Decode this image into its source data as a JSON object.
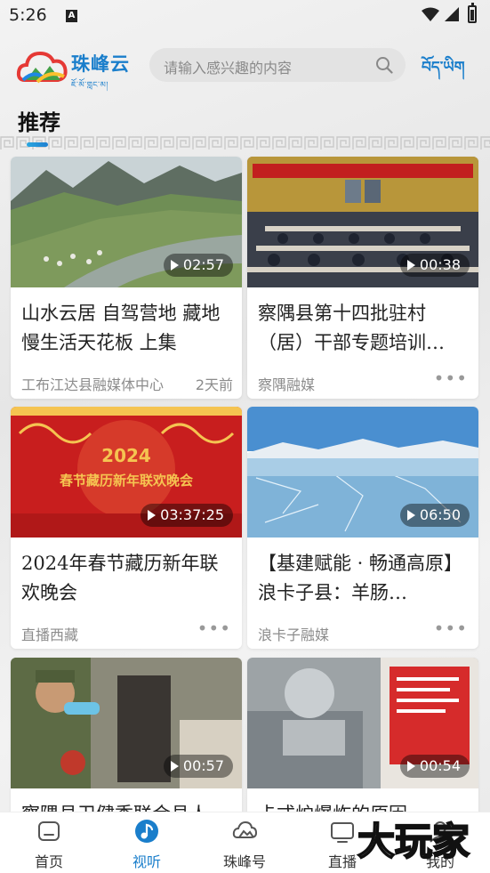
{
  "status_bar": {
    "time": "5:26",
    "notification_icon": "A"
  },
  "header": {
    "logo_name": "珠峰云",
    "logo_subtitle": "ཇོ་མོ་གླང་མ།",
    "search_placeholder": "请输入感兴趣的内容",
    "language_switch": "བོད་ཡིག"
  },
  "section": {
    "title": "推荐"
  },
  "cards": [
    {
      "title": "山水云居 自驾营地 藏地慢生活天花板 上集",
      "source": "工布江达县融媒体中心",
      "time": "2天前",
      "duration": "02:57",
      "image": "mountain-river-camp"
    },
    {
      "title": "察隅县第十四批驻村（居）干部专题培训…",
      "source": "察隅融媒",
      "time": "",
      "duration": "00:38",
      "image": "meeting-hall"
    },
    {
      "title": "2024年春节藏历新年联欢晚会",
      "source": "直播西藏",
      "time": "",
      "duration": "03:37:25",
      "image": "festival-stage"
    },
    {
      "title": "【基建赋能 · 畅通高原】浪卡子县：羊肠…",
      "source": "浪卡子融媒",
      "time": "",
      "duration": "06:50",
      "image": "frozen-lake"
    },
    {
      "title": "察隅县卫健委联合县人…",
      "source": "",
      "time": "",
      "duration": "00:57",
      "image": "medical-outreach"
    },
    {
      "title": "卡式炉爆炸的原因",
      "source": "",
      "time": "",
      "duration": "00:54",
      "image": "gas-canister"
    }
  ],
  "bottom_nav": [
    {
      "label": "首页",
      "icon": "home-icon",
      "active": false
    },
    {
      "label": "视听",
      "icon": "music-note-icon",
      "active": true
    },
    {
      "label": "珠峰号",
      "icon": "cloud-icon",
      "active": false
    },
    {
      "label": "直播",
      "icon": "live-tv-icon",
      "active": false
    },
    {
      "label": "我的",
      "icon": "profile-icon",
      "active": false
    }
  ],
  "watermark": {
    "text": "大玩家"
  },
  "colors": {
    "accent": "#1a7ecb",
    "festival_red": "#c81e1e",
    "festival_gold": "#f5c451"
  }
}
